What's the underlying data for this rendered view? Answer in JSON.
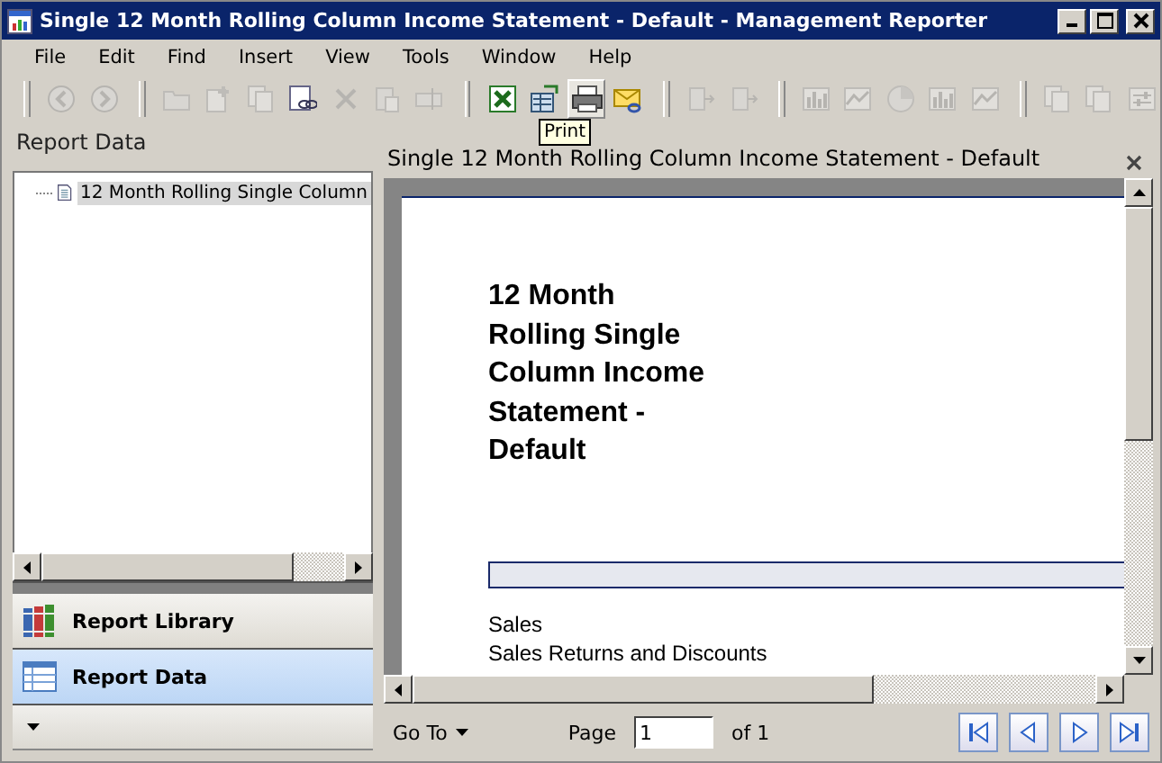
{
  "window": {
    "title": "Single 12 Month Rolling Column Income Statement - Default - Management Reporter"
  },
  "menu": [
    "File",
    "Edit",
    "Find",
    "Insert",
    "View",
    "Tools",
    "Window",
    "Help"
  ],
  "toolbar_groups": [
    [
      {
        "kind": "back",
        "disabled": true,
        "highlighted": false
      },
      {
        "kind": "forward",
        "disabled": true,
        "highlighted": false
      }
    ],
    [
      {
        "kind": "folder",
        "disabled": true,
        "highlighted": false
      },
      {
        "kind": "new",
        "disabled": true,
        "highlighted": false
      },
      {
        "kind": "copy",
        "disabled": true,
        "highlighted": false
      },
      {
        "kind": "link",
        "disabled": false,
        "highlighted": false
      },
      {
        "kind": "delete",
        "disabled": true,
        "highlighted": false
      },
      {
        "kind": "paste",
        "disabled": true,
        "highlighted": false
      },
      {
        "kind": "rename",
        "disabled": true,
        "highlighted": false
      }
    ],
    [
      {
        "kind": "excel",
        "disabled": false,
        "highlighted": false
      },
      {
        "kind": "export",
        "disabled": false,
        "highlighted": false
      },
      {
        "kind": "print",
        "disabled": false,
        "highlighted": true
      },
      {
        "kind": "mail",
        "disabled": false,
        "highlighted": false
      }
    ],
    [
      {
        "kind": "grid",
        "disabled": true,
        "highlighted": false
      },
      {
        "kind": "drill",
        "disabled": true,
        "highlighted": false
      }
    ],
    [
      {
        "kind": "bars",
        "disabled": true,
        "highlighted": false
      },
      {
        "kind": "line",
        "disabled": true,
        "highlighted": false
      },
      {
        "kind": "pie",
        "disabled": true,
        "highlighted": false
      },
      {
        "kind": "bars",
        "disabled": true,
        "highlighted": false
      },
      {
        "kind": "area",
        "disabled": true,
        "highlighted": false
      }
    ],
    [
      {
        "kind": "page",
        "disabled": true,
        "highlighted": false
      },
      {
        "kind": "copy",
        "disabled": true,
        "highlighted": false
      },
      {
        "kind": "settings",
        "disabled": true,
        "highlighted": false
      }
    ]
  ],
  "tooltip": "Print",
  "left_panel": {
    "title": "Report Data",
    "tree": [
      {
        "label": "12 Month Rolling Single Column",
        "selected": true
      }
    ],
    "nav": [
      {
        "label": "Report Library",
        "kind": "library",
        "selected": false
      },
      {
        "label": "Report Data",
        "kind": "data",
        "selected": true
      }
    ]
  },
  "document": {
    "title": "Single 12 Month Rolling Column Income Statement - Default",
    "report_title": [
      "12 Month",
      "Rolling Single",
      "Column Income",
      "Statement -",
      "Default"
    ],
    "rows": [
      "Sales",
      "Sales Returns and Discounts"
    ]
  },
  "footer": {
    "goto": "Go To",
    "page_label": "Page",
    "page_value": "1",
    "page_total": "of 1",
    "nav": [
      {
        "kind": "first"
      },
      {
        "kind": "prev"
      },
      {
        "kind": "next"
      },
      {
        "kind": "last"
      }
    ]
  }
}
